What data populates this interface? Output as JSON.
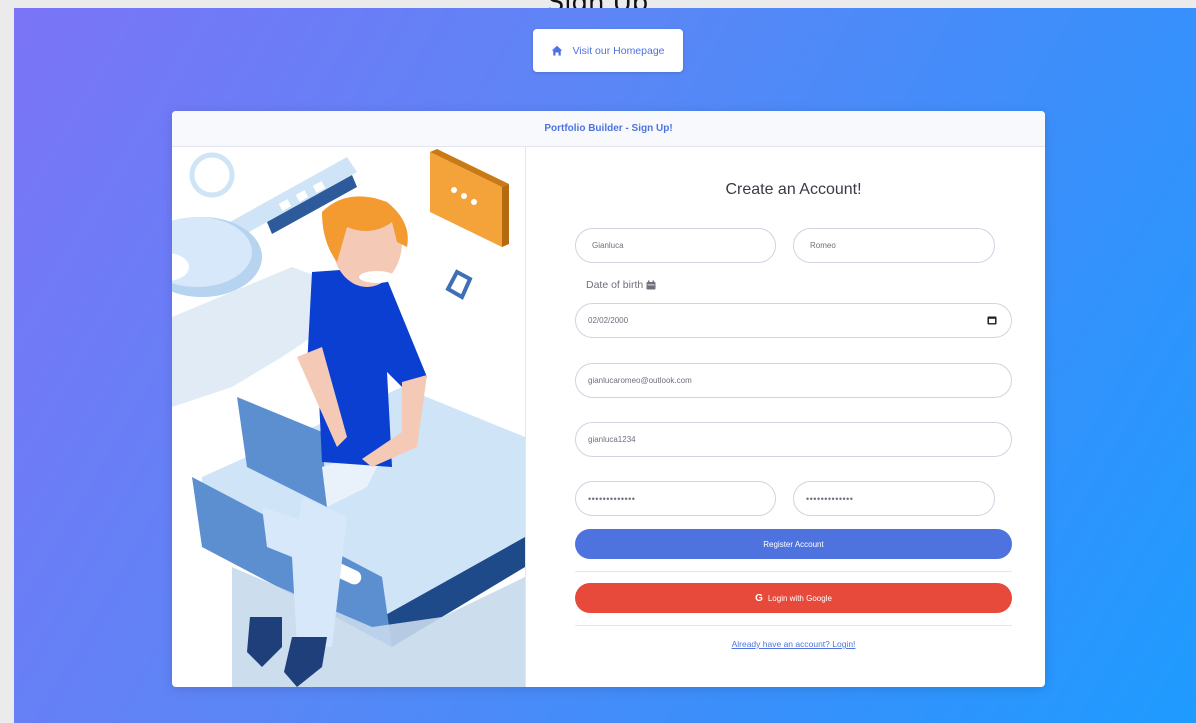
{
  "window": {
    "title": "Sign Up"
  },
  "home_button": {
    "label": "Visit our Homepage",
    "icon": "home-icon"
  },
  "card": {
    "header": "Portfolio Builder - Sign Up!",
    "form_title": "Create an Account!",
    "first_name": "Gianluca",
    "last_name": "Romeo",
    "dob_label": "Date of birth",
    "dob_value": "02/02/2000",
    "email": "gianlucaromeo@outlook.com",
    "username": "gianluca1234",
    "password": "•••••••••••••",
    "password_repeat": "•••••••••••••",
    "register_label": "Register Account",
    "google_label": "Login with Google",
    "login_link": "Already have an account? Login!"
  },
  "colors": {
    "primary": "#4e73df",
    "google": "#e74a3b",
    "gradient_start": "#7b74f7",
    "gradient_end": "#1e9bff"
  }
}
